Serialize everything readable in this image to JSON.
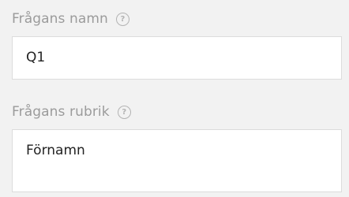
{
  "fields": [
    {
      "label": "Frågans namn",
      "value": "Q1",
      "help_icon": "question-circle-icon"
    },
    {
      "label": "Frågans rubrik",
      "value": "Förnamn",
      "help_icon": "question-circle-icon"
    }
  ],
  "colors": {
    "background": "#f2f2f2",
    "label": "#9b9b9b",
    "input_background": "#ffffff",
    "input_border": "#dcdcdc",
    "text": "#222222"
  }
}
